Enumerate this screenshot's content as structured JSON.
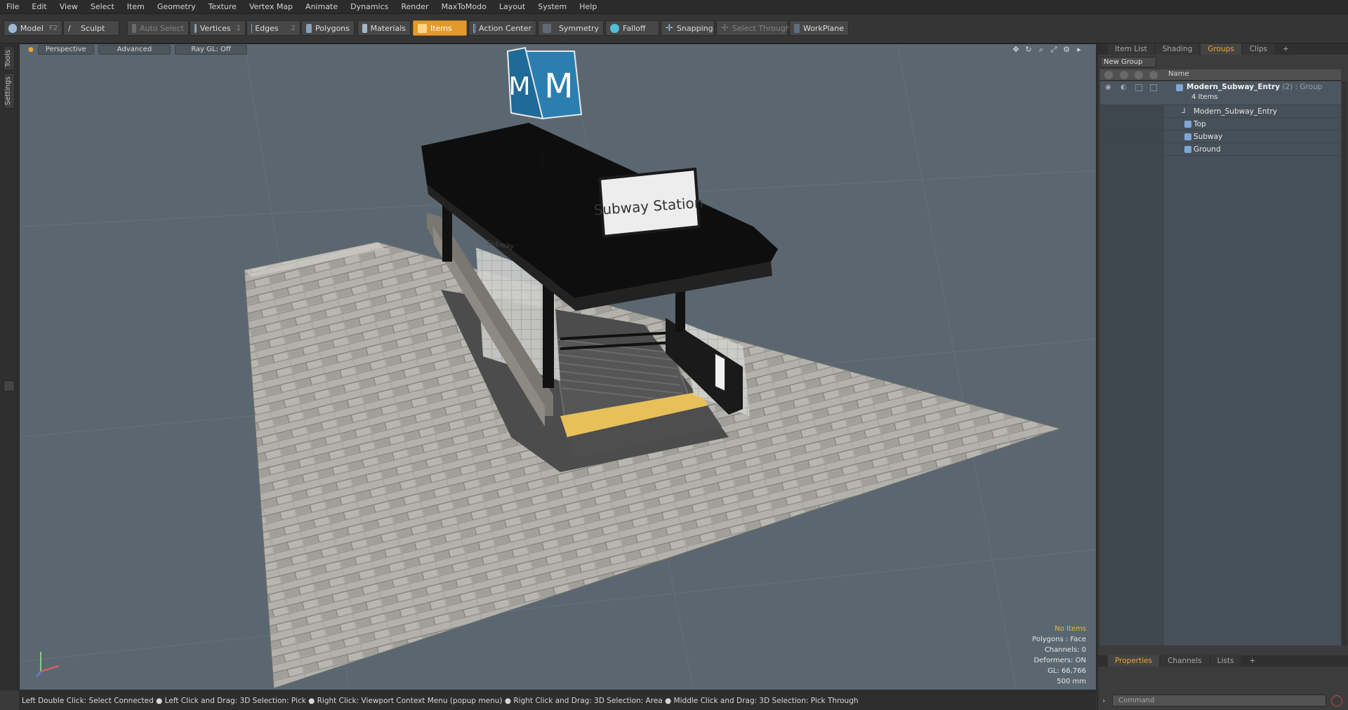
{
  "menu": [
    "File",
    "Edit",
    "View",
    "Select",
    "Item",
    "Geometry",
    "Texture",
    "Vertex Map",
    "Animate",
    "Dynamics",
    "Render",
    "MaxToModo",
    "Layout",
    "System",
    "Help"
  ],
  "toolbar": {
    "model": "Model",
    "model_key": "F2",
    "sculpt": "Sculpt",
    "auto_select": "Auto Select",
    "vertices": "Vertices",
    "vertices_key": "1",
    "edges": "Edges",
    "edges_key": "2",
    "polygons": "Polygons",
    "materials": "Materials",
    "items": "Items",
    "action_center": "Action Center",
    "symmetry": "Symmetry",
    "falloff": "Falloff",
    "snapping": "Snapping",
    "select_through": "Select Through",
    "workplane": "WorkPlane"
  },
  "left_tabs": [
    "Tools",
    "Settings"
  ],
  "viewport": {
    "view": "Perspective",
    "shading": "Advanced",
    "raygl": "Ray GL: Off",
    "sign_text": "Subway Station",
    "side_sign_text": "Subway",
    "cube_letter": "M",
    "info": {
      "selection": "No Items",
      "polygons": "Polygons : Face",
      "channels": "Channels: 0",
      "deformers": "Deformers: ON",
      "gl": "GL: 66,766",
      "scale": "500 mm"
    }
  },
  "status": "Left Double Click: Select Connected ● Left Click and Drag: 3D Selection: Pick ● Right Click: Viewport Context Menu (popup menu) ● Right Click and Drag: 3D Selection: Area ● Middle Click and Drag: 3D Selection: Pick Through",
  "panel": {
    "tabs": [
      "Item List",
      "Shading",
      "Groups",
      "Clips",
      "+"
    ],
    "new_group": "New Group",
    "name_header": "Name",
    "group_name": "Modern_Subway_Entry",
    "group_count": "(2)",
    "group_type": ": Group",
    "group_items": "4 Items",
    "children": [
      "Modern_Subway_Entry",
      "Top",
      "Subway",
      "Ground"
    ],
    "bottom_tabs": [
      "Properties",
      "Channels",
      "Lists",
      "+"
    ],
    "command_placeholder": "Command"
  },
  "colors": {
    "accent": "#e39a2c",
    "viewport_bg": "#5b6770",
    "cube_blue": "#2a7fb0",
    "yellow_line": "#e8c05a"
  }
}
